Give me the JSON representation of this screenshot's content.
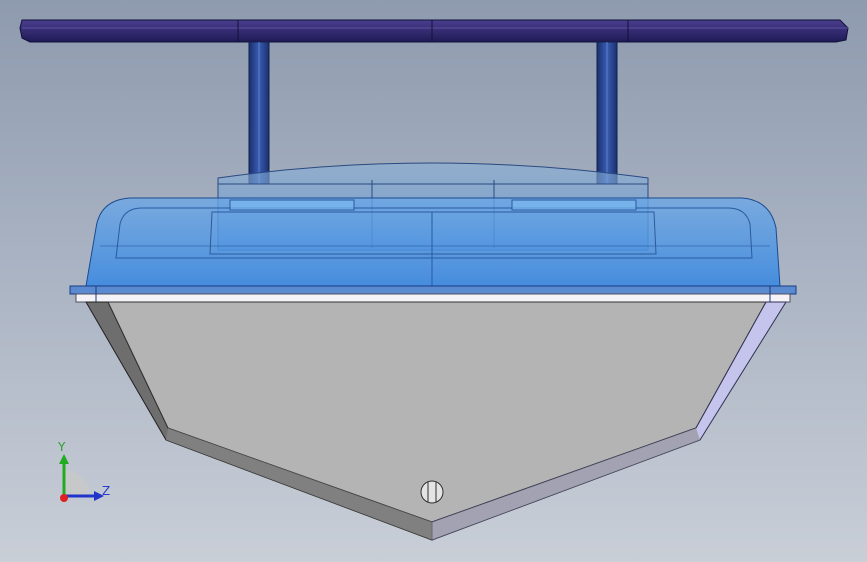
{
  "viewport": {
    "background_top": "#8e9aae",
    "background_bottom": "#c9ced7"
  },
  "model": {
    "roof_color": "#2a2a6e",
    "post_color": "#2a4a9a",
    "cabin_color": "#3a8ae0",
    "hull_color": "#b0b0b0",
    "hull_side_dark": "#6a6a6a",
    "hull_side_light": "#c8c8f0"
  },
  "triad": {
    "y_label": "Y",
    "z_label": "Z",
    "y_color": "#22aa22",
    "z_color": "#2233cc",
    "x_color": "#dd2222"
  }
}
